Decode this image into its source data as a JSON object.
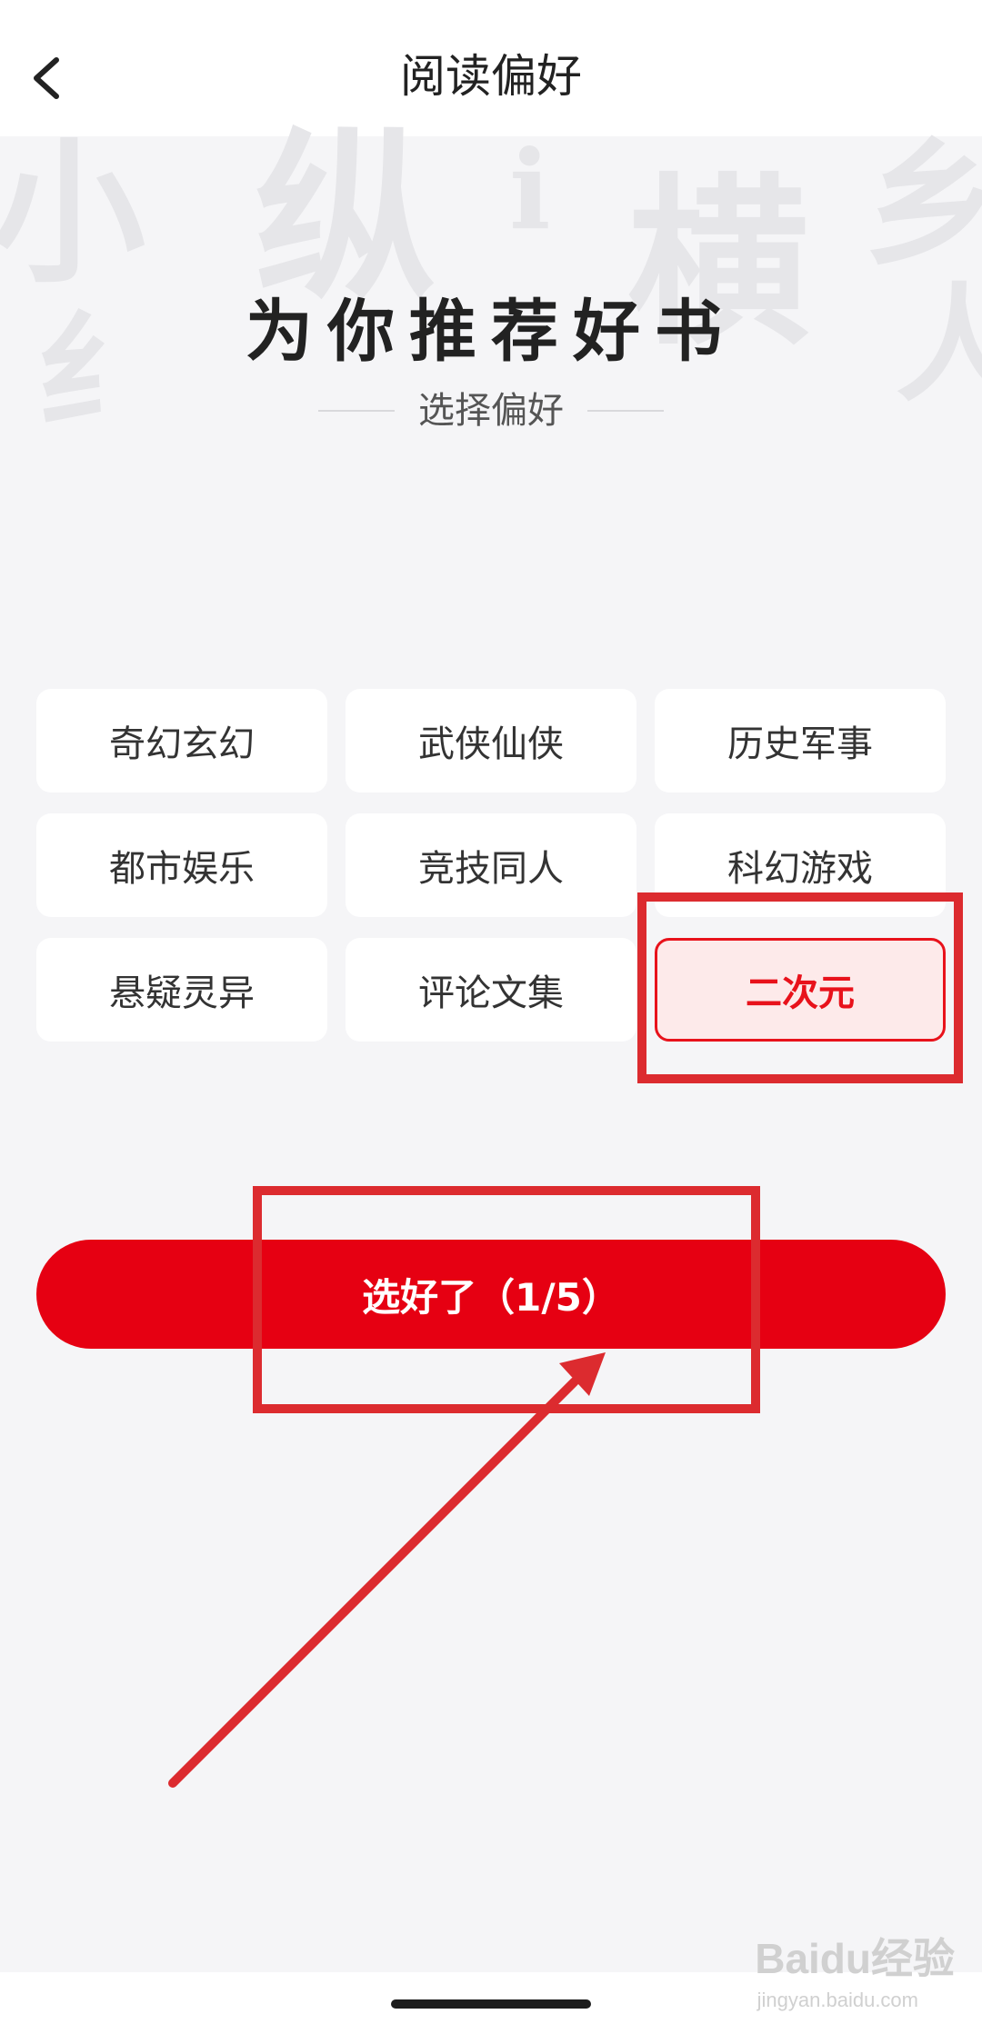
{
  "header": {
    "title": "阅读偏好",
    "back_icon": "chevron-left-icon"
  },
  "background_decoration": [
    "小",
    "纵",
    "i",
    "横",
    "乡",
    "纟",
    "人"
  ],
  "hero": {
    "title": "为你推荐好书",
    "subtitle": "选择偏好"
  },
  "categories": [
    {
      "label": "奇幻玄幻",
      "selected": false
    },
    {
      "label": "武侠仙侠",
      "selected": false
    },
    {
      "label": "历史军事",
      "selected": false
    },
    {
      "label": "都市娱乐",
      "selected": false
    },
    {
      "label": "竞技同人",
      "selected": false
    },
    {
      "label": "科幻游戏",
      "selected": false
    },
    {
      "label": "悬疑灵异",
      "selected": false
    },
    {
      "label": "评论文集",
      "selected": false
    },
    {
      "label": "二次元",
      "selected": true
    }
  ],
  "confirm_button": {
    "label": "选好了（1/5）"
  },
  "watermark": {
    "text": "Baidu经验",
    "sub": "jingyan.baidu.com"
  },
  "colors": {
    "accent": "#e60012",
    "selected_bg": "#fdeaea",
    "annotation": "#dc2b2f",
    "page_bg": "#f5f5f7"
  }
}
